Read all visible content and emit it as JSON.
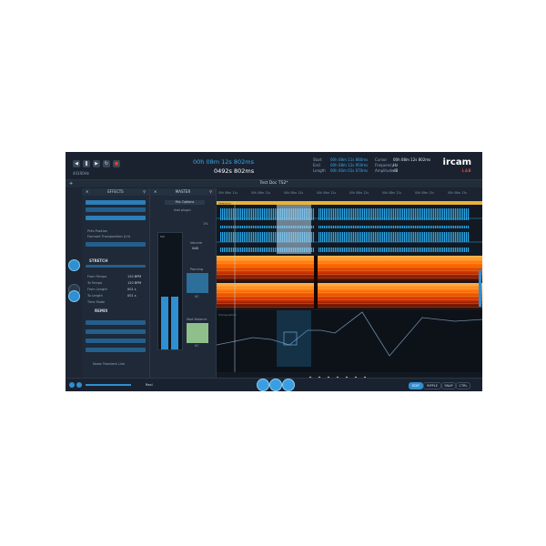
{
  "app": {
    "sample_rate": "44100Hz",
    "time_main": "00h 08m 12s 802ms",
    "time_sub": "0492s 802ms",
    "session_title": "Test Doc TS2*",
    "logo_line1": "ircam",
    "logo_line2": "LAB"
  },
  "selection_info": {
    "labels": [
      "Start",
      "End",
      "Length"
    ],
    "values": [
      "00h 08m 11s 880ms",
      "00h 08m 12s 950ms",
      "00h 00m 01s 070ms"
    ],
    "cursor_labels": [
      "Cursor",
      "Frequency",
      "Amplitude"
    ],
    "cursor_values": [
      "00h 08m 12s 802ms",
      "Hz",
      "dB"
    ]
  },
  "effects": {
    "title": "EFFECTS",
    "item_preserve": "Prés Position",
    "item_formant": "Formant Transposition (LH)",
    "stretch_title": "STRETCH",
    "stretch_rows": [
      {
        "label": "From Tempo",
        "value": "120 BPM"
      },
      {
        "label": "To Tempo",
        "value": "120 BPM"
      },
      {
        "label": "From Length",
        "value": "001 s"
      },
      {
        "label": "To Length",
        "value": "001 s"
      },
      {
        "label": "Time Mode",
        "value": ""
      }
    ],
    "remix_title": "REMIX",
    "remix_footer": "Noise Transient Link",
    "footer_value": "Real"
  },
  "master": {
    "title": "MASTER",
    "mix_label": "Mix Options",
    "add_plugin": "Add plugin",
    "gain_label": "Volume",
    "gain_value": "0dB",
    "panning_label": "Panning",
    "panning_value": "0C",
    "mod_label": "Mod Balance",
    "mod_value": "0C",
    "percent": "1%",
    "meter_label": "Mix"
  },
  "ruler": {
    "ticks": [
      "00h 08m 11s",
      "00h 08m 11s",
      "00h 08m 12s",
      "00h 08m 12s",
      "00h 08m 12s",
      "00h 08m 12s",
      "00h 08m 13s",
      "00h 08m 13s"
    ]
  },
  "tracks": {
    "label_top": "Selection",
    "label_env": "Transposition"
  },
  "bottom": {
    "modes": [
      "EDIT",
      "RIPPLE",
      "SNAP",
      "CTRL"
    ],
    "active_mode": "EDIT"
  },
  "colors": {
    "accent": "#2f8fd0",
    "waveform": "#2aa6e6",
    "spectrogram_hot": "#ff8a1a",
    "spectrogram_bg": "#1a0500",
    "selection": "#3fa0d8"
  }
}
